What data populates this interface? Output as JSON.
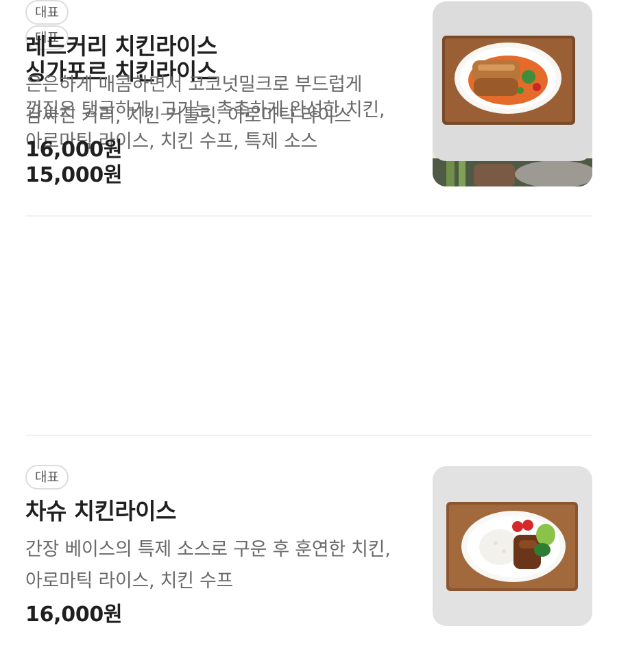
{
  "menu": {
    "items": [
      {
        "badge": "대표",
        "title": "싱가포르 치킨라이스",
        "description": "껍질은 탱글하게, 고기는 촉촉하게 완성한 치킨, 아로마틱 라이스, 치킨 수프, 특제 소스",
        "price": "15,000원",
        "image_icon": "food-photo-collage"
      },
      {
        "badge": "대표",
        "title": "차슈 치킨라이스",
        "description": "간장 베이스의 특제 소스로 구운 후 훈연한 치킨, 아로마틱 라이스, 치킨 수프",
        "price": "16,000원",
        "image_icon": "food-photo-plate"
      },
      {
        "badge": "대표",
        "title": "레드커리 치킨라이스",
        "description": "은은하게 매콤하면서 코코넛밀크로 부드럽게 감싸진 커리, 치킨 커틀릿, 아로마틱 라이스",
        "price": "16,000원",
        "image_icon": "food-photo-curry"
      }
    ]
  }
}
